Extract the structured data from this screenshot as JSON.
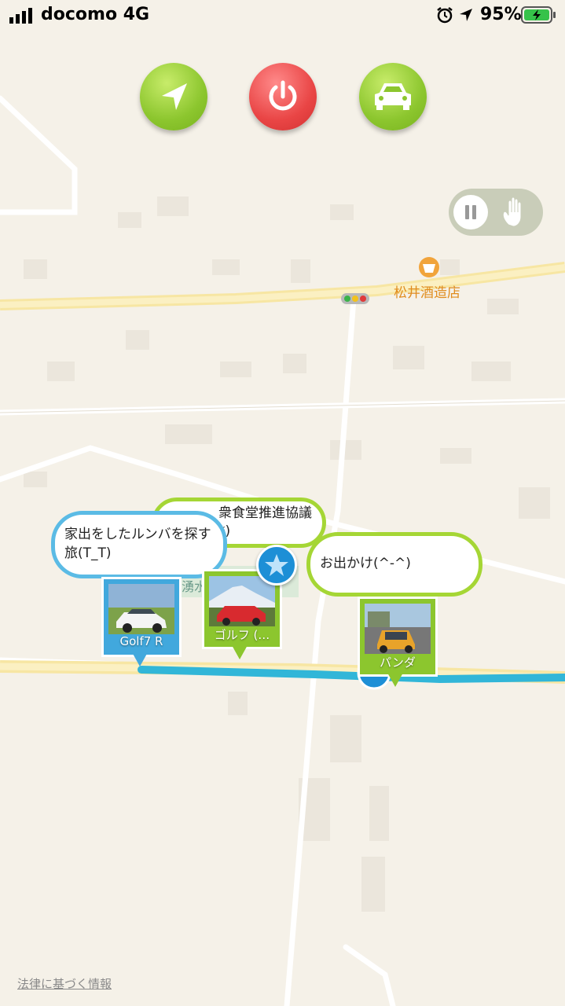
{
  "status_bar": {
    "carrier": "docomo  4G",
    "battery": "95%"
  },
  "controls": {
    "navigate_icon": "navigation-arrow-icon",
    "power_icon": "power-icon",
    "car_icon": "car-icon",
    "pause_icon": "pause-icon",
    "hand_icon": "hand-icon"
  },
  "map": {
    "poi_name": "松井酒造店",
    "water_label": "湧水",
    "legal_link": "法律に基づく情報"
  },
  "bubbles": [
    {
      "text_line1": "家出をしたルンバを探す",
      "text_line2": "旅(T_T)"
    },
    {
      "text_line1": "衆食堂推進協議",
      "text_line2": "*)"
    },
    {
      "text_line1": "お出かけ(^-^)",
      "text_line2": ""
    }
  ],
  "pins": [
    {
      "label": "Golf7 R",
      "color": "#41a8dd"
    },
    {
      "label": "ゴルフ (…",
      "color": "#8cc62e"
    },
    {
      "label": "パンダ",
      "color": "#8cc62e"
    }
  ],
  "colors": {
    "route": "#31b6d8",
    "button_green": "#8cc62e",
    "button_red": "#e94545",
    "poi": "#e08c1d"
  }
}
